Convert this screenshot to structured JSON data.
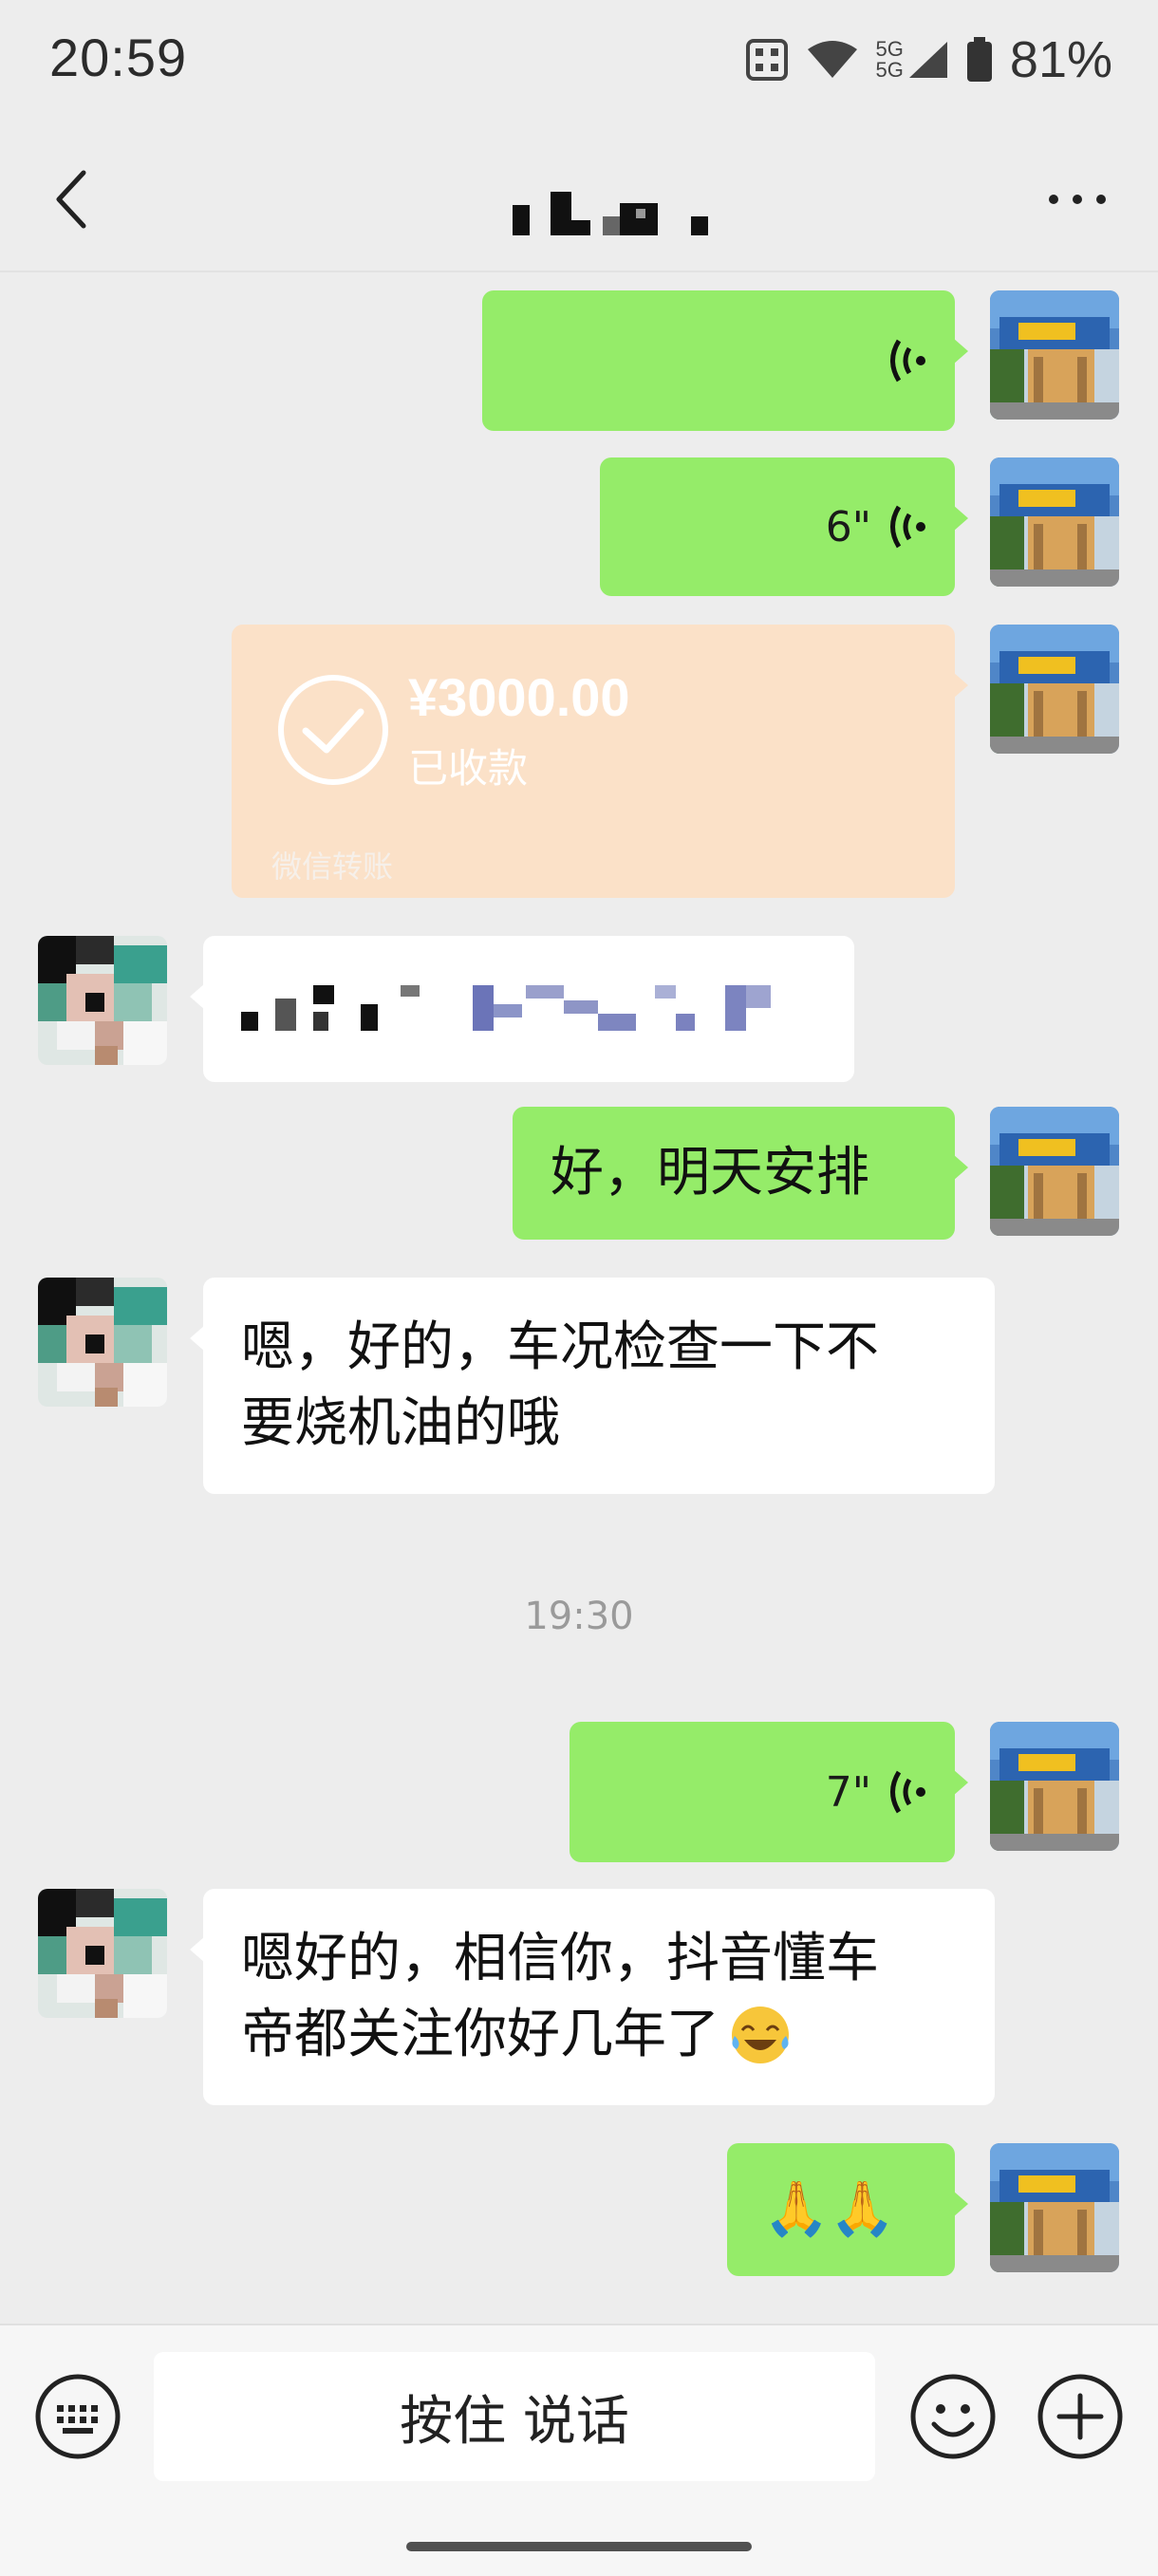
{
  "status_bar": {
    "time": "20:59",
    "network": "5G",
    "battery": "81%"
  },
  "nav": {
    "back_icon": "chevron-left-icon",
    "more_icon": "more-dots-icon"
  },
  "messages": {
    "voice1": {
      "duration": ""
    },
    "voice2": {
      "duration": "6\""
    },
    "transfer": {
      "amount": "¥3000.00",
      "status": "已收款",
      "footer": "微信转账"
    },
    "me1": {
      "text": "好，明天安排"
    },
    "other2": {
      "line1": "嗯，好的，车况检查一下不",
      "line2": "要烧机油的哦"
    },
    "timestamp": "19:30",
    "voice3": {
      "duration": "7\""
    },
    "other3": {
      "line1": "嗯好的，相信你，抖音懂车",
      "line2": "帝都关注你好几年了"
    },
    "me2": {
      "text": "🙏🙏"
    }
  },
  "input_bar": {
    "hold_to_talk": "按住 说话",
    "keyboard_icon": "keyboard-icon",
    "emoji_icon": "emoji-icon",
    "plus_icon": "plus-icon"
  },
  "colors": {
    "sent_bubble": "#95ec69",
    "received_bubble": "#ffffff",
    "transfer_bubble": "#fbe1c8",
    "background": "#ededed"
  }
}
